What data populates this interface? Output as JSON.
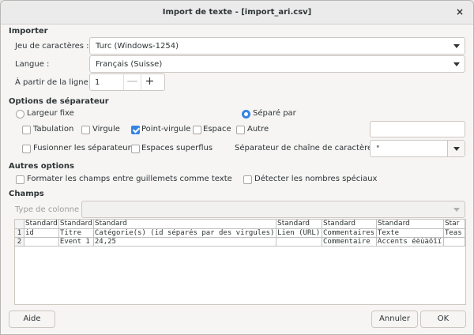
{
  "window": {
    "title": "Import de texte - [import_ari.csv]",
    "close_glyph": "×"
  },
  "importer": {
    "heading": "Importer",
    "charset_label": "Jeu de caractères :",
    "charset_value": "Turc (Windows-1254)",
    "language_label": "Langue :",
    "language_value": "Français (Suisse)",
    "from_line_label": "À partir de la ligne :",
    "from_line_value": "1",
    "minus_glyph": "—",
    "plus_glyph": "+"
  },
  "separator": {
    "heading": "Options de séparateur",
    "fixed_width": "Largeur fixe",
    "separated_by": "Séparé par",
    "tab": "Tabulation",
    "comma": "Virgule",
    "semicolon": "Point-virgule",
    "space": "Espace",
    "other": "Autre",
    "merge": "Fusionner les séparateurs",
    "trim": "Espaces superflus",
    "string_delim_label": "Séparateur de chaîne de caractères :",
    "string_delim_value": "\""
  },
  "other_options": {
    "heading": "Autres options",
    "quoted_as_text": "Formater les champs entre guillemets comme texte",
    "detect_special": "Détecter les nombres spéciaux"
  },
  "fields": {
    "heading": "Champs",
    "column_type_label": "Type de colonne :",
    "column_type_value": ""
  },
  "table": {
    "headers": [
      "Standard",
      "Standard",
      "Standard",
      "Standard",
      "Standard",
      "Standard",
      "Star"
    ],
    "rows": [
      {
        "num": "1",
        "cells": [
          "id",
          "Titre",
          "Catégorie(s) (id séparés par des virgules)",
          "Lien (URL)",
          "Commentaires",
          "Texte",
          "Teas"
        ]
      },
      {
        "num": "2",
        "cells": [
          "",
          "Event 1",
          "24,25",
          "",
          "Commentaire",
          "Accents éèùàöîï",
          ""
        ]
      }
    ]
  },
  "buttons": {
    "help": "Aide",
    "cancel": "Annuler",
    "ok": "OK"
  },
  "colors": {
    "accent": "#3584e4"
  }
}
